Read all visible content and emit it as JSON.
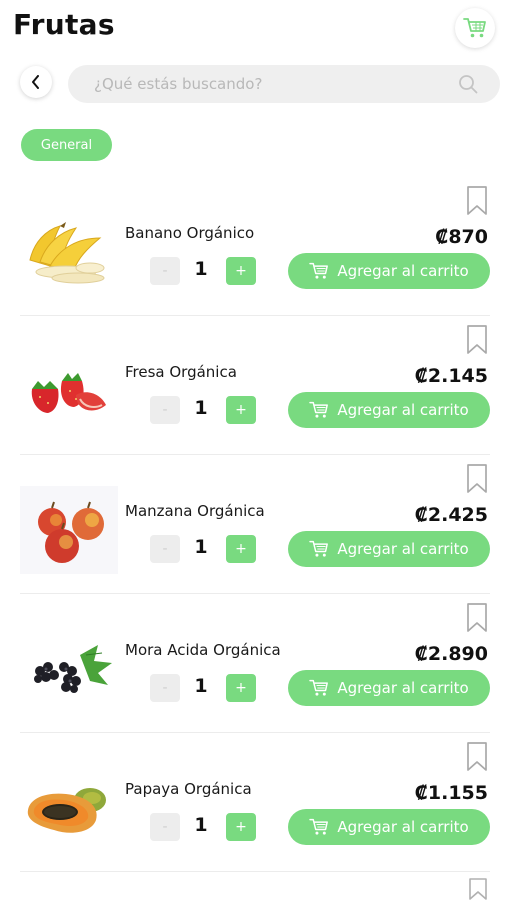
{
  "header": {
    "title": "Frutas",
    "cart_icon": "cart-icon"
  },
  "search": {
    "back_icon": "chevron-left-icon",
    "placeholder": "¿Qué estás buscando?",
    "value": "",
    "icon": "search-icon"
  },
  "filter": {
    "chip_label": "General"
  },
  "colors": {
    "accent": "#79da80",
    "search_bg": "#efefef",
    "minus_bg": "#ededed"
  },
  "products": [
    {
      "name": "Banano Orgánico",
      "price": "₡870",
      "quantity": "1",
      "minus": "-",
      "plus": "+",
      "add_label": "Agregar al carrito",
      "image_icon": "banana-image"
    },
    {
      "name": "Fresa Orgánica",
      "price": "₡2.145",
      "quantity": "1",
      "minus": "-",
      "plus": "+",
      "add_label": "Agregar al carrito",
      "image_icon": "strawberry-image"
    },
    {
      "name": "Manzana Orgánica",
      "price": "₡2.425",
      "quantity": "1",
      "minus": "-",
      "plus": "+",
      "add_label": "Agregar al carrito",
      "image_icon": "apple-image"
    },
    {
      "name": "Mora Acida Orgánica",
      "price": "₡2.890",
      "quantity": "1",
      "minus": "-",
      "plus": "+",
      "add_label": "Agregar al carrito",
      "image_icon": "blackberry-image"
    },
    {
      "name": "Papaya Orgánica",
      "price": "₡1.155",
      "quantity": "1",
      "minus": "-",
      "plus": "+",
      "add_label": "Agregar al carrito",
      "image_icon": "papaya-image"
    }
  ]
}
